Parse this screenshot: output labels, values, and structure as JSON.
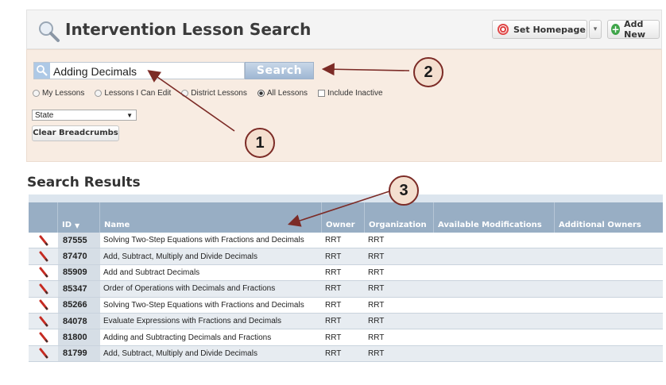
{
  "header": {
    "title": "Intervention Lesson Search",
    "set_homepage_label": "Set Homepage",
    "add_new_label": "Add New"
  },
  "search": {
    "value": "Adding Decimals",
    "button_label": "Search",
    "filters": {
      "my_lessons": "My Lessons",
      "lessons_i_can_edit": "Lessons I Can Edit",
      "district_lessons": "District Lessons",
      "all_lessons": "All Lessons",
      "include_inactive": "Include Inactive",
      "selected": "all_lessons"
    },
    "scope_select_value": "State",
    "clear_breadcrumbs_label": "Clear Breadcrumbs"
  },
  "results": {
    "title": "Search Results",
    "columns": {
      "id": "ID",
      "name": "Name",
      "owner": "Owner",
      "organization": "Organization",
      "available_modifications": "Available Modifications",
      "additional_owners": "Additional Owners"
    },
    "rows": [
      {
        "id": "87555",
        "name": "Solving Two-Step Equations with Fractions and Decimals",
        "owner": "RRT",
        "organization": "RRT"
      },
      {
        "id": "87470",
        "name": "Add, Subtract, Multiply and Divide Decimals",
        "owner": "RRT",
        "organization": "RRT"
      },
      {
        "id": "85909",
        "name": "Add and Subtract Decimals",
        "owner": "RRT",
        "organization": "RRT"
      },
      {
        "id": "85347",
        "name": "Order of Operations with Decimals and Fractions",
        "owner": "RRT",
        "organization": "RRT"
      },
      {
        "id": "85266",
        "name": "Solving Two-Step Equations with Fractions and Decimals",
        "owner": "RRT",
        "organization": "RRT"
      },
      {
        "id": "84078",
        "name": "Evaluate Expressions with Fractions and Decimals",
        "owner": "RRT",
        "organization": "RRT"
      },
      {
        "id": "81800",
        "name": "Adding and Subtracting Decimals and Fractions",
        "owner": "RRT",
        "organization": "RRT"
      },
      {
        "id": "81799",
        "name": "Add, Subtract, Multiply and Divide Decimals",
        "owner": "RRT",
        "organization": "RRT"
      }
    ]
  },
  "annotations": {
    "callout_1": "1",
    "callout_2": "2",
    "callout_3": "3"
  },
  "colors": {
    "accent_arrow": "#7c2b26",
    "grid_header": "#98aec4",
    "search_panel": "#f8ece2"
  },
  "icons": {
    "title": "magnifier-icon",
    "edit": "pencil-icon",
    "set_homepage": "target-icon",
    "add_new": "plus-circle-icon"
  }
}
